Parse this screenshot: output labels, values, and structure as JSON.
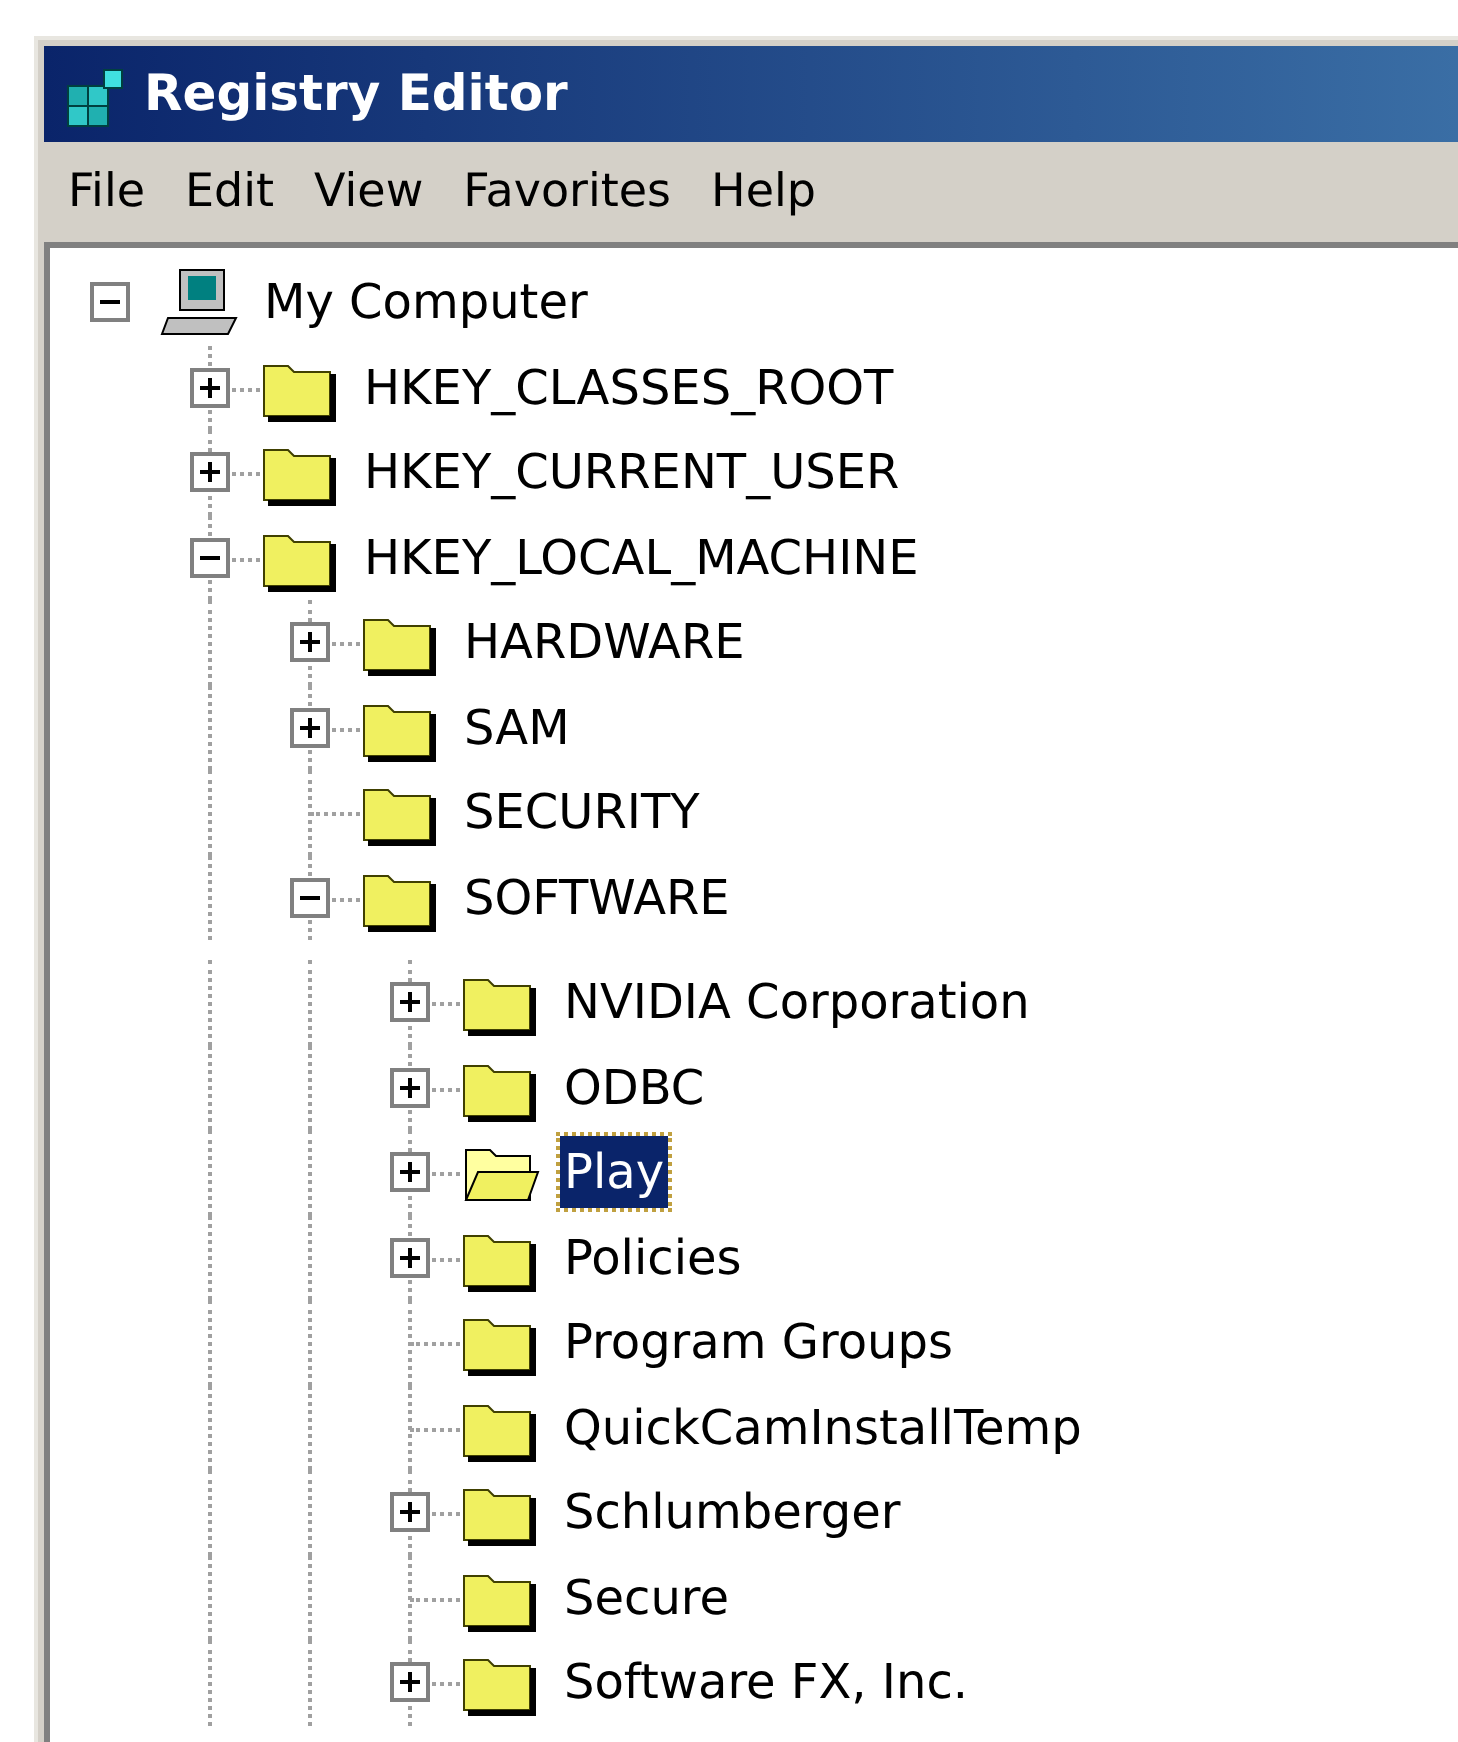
{
  "window": {
    "title": "Registry Editor"
  },
  "menu_bar": [
    "File",
    "Edit",
    "View",
    "Favorites",
    "Help"
  ],
  "tree": [
    {
      "label": "My Computer",
      "kind": "computer",
      "expanded": true,
      "selected": false,
      "children": [
        {
          "label": "HKEY_CLASSES_ROOT",
          "kind": "folder",
          "expanded": false,
          "selected": false
        },
        {
          "label": "HKEY_CURRENT_USER",
          "kind": "folder",
          "expanded": false,
          "selected": false
        },
        {
          "label": "HKEY_LOCAL_MACHINE",
          "kind": "folder",
          "expanded": true,
          "selected": false,
          "children": [
            {
              "label": "HARDWARE",
              "kind": "folder",
              "expanded": false,
              "selected": false
            },
            {
              "label": "SAM",
              "kind": "folder",
              "expanded": false,
              "selected": false
            },
            {
              "label": "SECURITY",
              "kind": "folder",
              "selected": false
            },
            {
              "label": "SOFTWARE",
              "kind": "folder",
              "expanded": true,
              "selected": false,
              "children": [
                {
                  "label": "NVIDIA Corporation",
                  "kind": "folder",
                  "expanded": false,
                  "selected": false
                },
                {
                  "label": "ODBC",
                  "kind": "folder",
                  "expanded": false,
                  "selected": false
                },
                {
                  "label": "Play",
                  "kind": "folder",
                  "expanded": false,
                  "selected": true
                },
                {
                  "label": "Policies",
                  "kind": "folder",
                  "expanded": false,
                  "selected": false
                },
                {
                  "label": "Program Groups",
                  "kind": "folder",
                  "selected": false
                },
                {
                  "label": "QuickCamInstallTemp",
                  "kind": "folder",
                  "selected": false
                },
                {
                  "label": "Schlumberger",
                  "kind": "folder",
                  "expanded": false,
                  "selected": false
                },
                {
                  "label": "Secure",
                  "kind": "folder",
                  "selected": false
                },
                {
                  "label": "Software FX, Inc.",
                  "kind": "folder",
                  "expanded": false,
                  "selected": false
                }
              ]
            }
          ]
        }
      ]
    }
  ]
}
